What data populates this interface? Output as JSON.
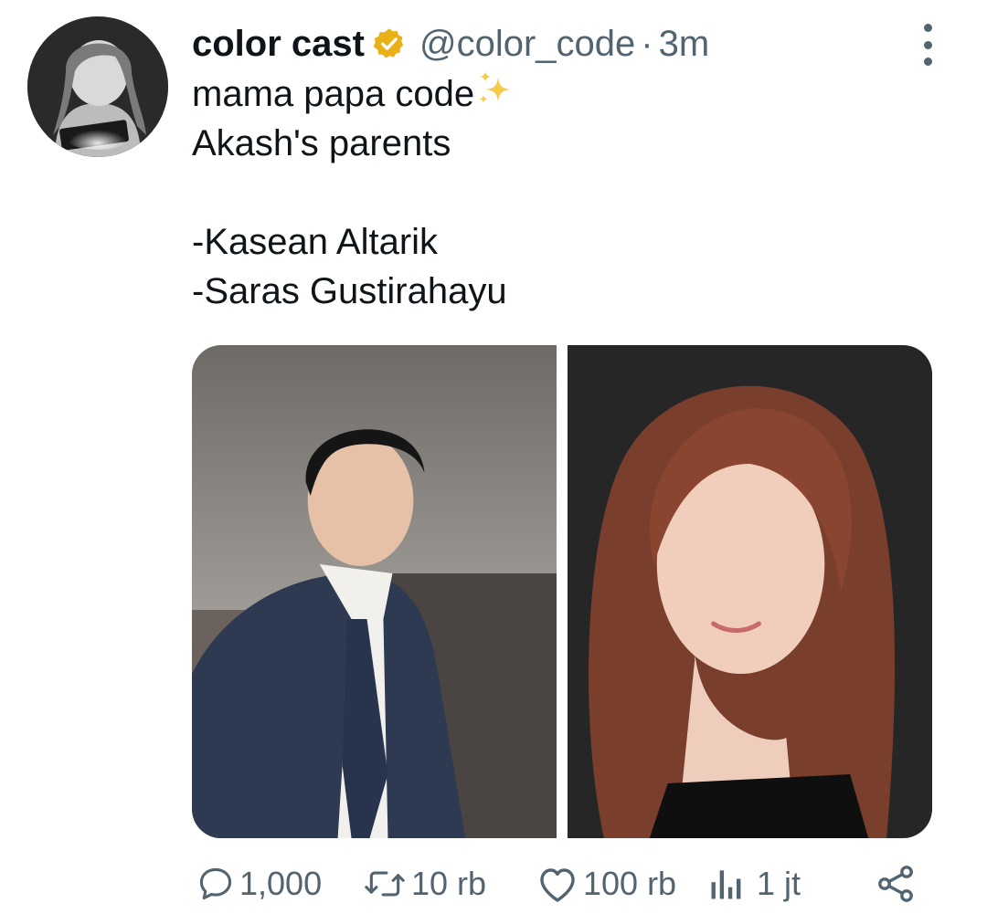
{
  "post": {
    "author_name": "color cast",
    "handle": "@color_code",
    "separator": "·",
    "time": "3m",
    "verified_badge_color": "#e9b017",
    "text_lines": [
      "mama papa code",
      "Akash's parents",
      "",
      "-Kasean Altarik",
      "-Saras Gustirahayu"
    ],
    "sparkle_icon": "sparkles-emoji",
    "media": [
      {
        "icon": "photo-man-in-suit"
      },
      {
        "icon": "photo-woman-portrait"
      }
    ]
  },
  "actions": {
    "reply": {
      "icon": "reply-icon",
      "count": "1,000"
    },
    "repost": {
      "icon": "repost-icon",
      "count": "10 rb"
    },
    "like": {
      "icon": "heart-icon",
      "count": "100 rb"
    },
    "views": {
      "icon": "views-chart-icon",
      "count": "1 jt"
    },
    "share": {
      "icon": "share-icon"
    }
  },
  "colors": {
    "text": "#0f1419",
    "secondary": "#536471"
  }
}
